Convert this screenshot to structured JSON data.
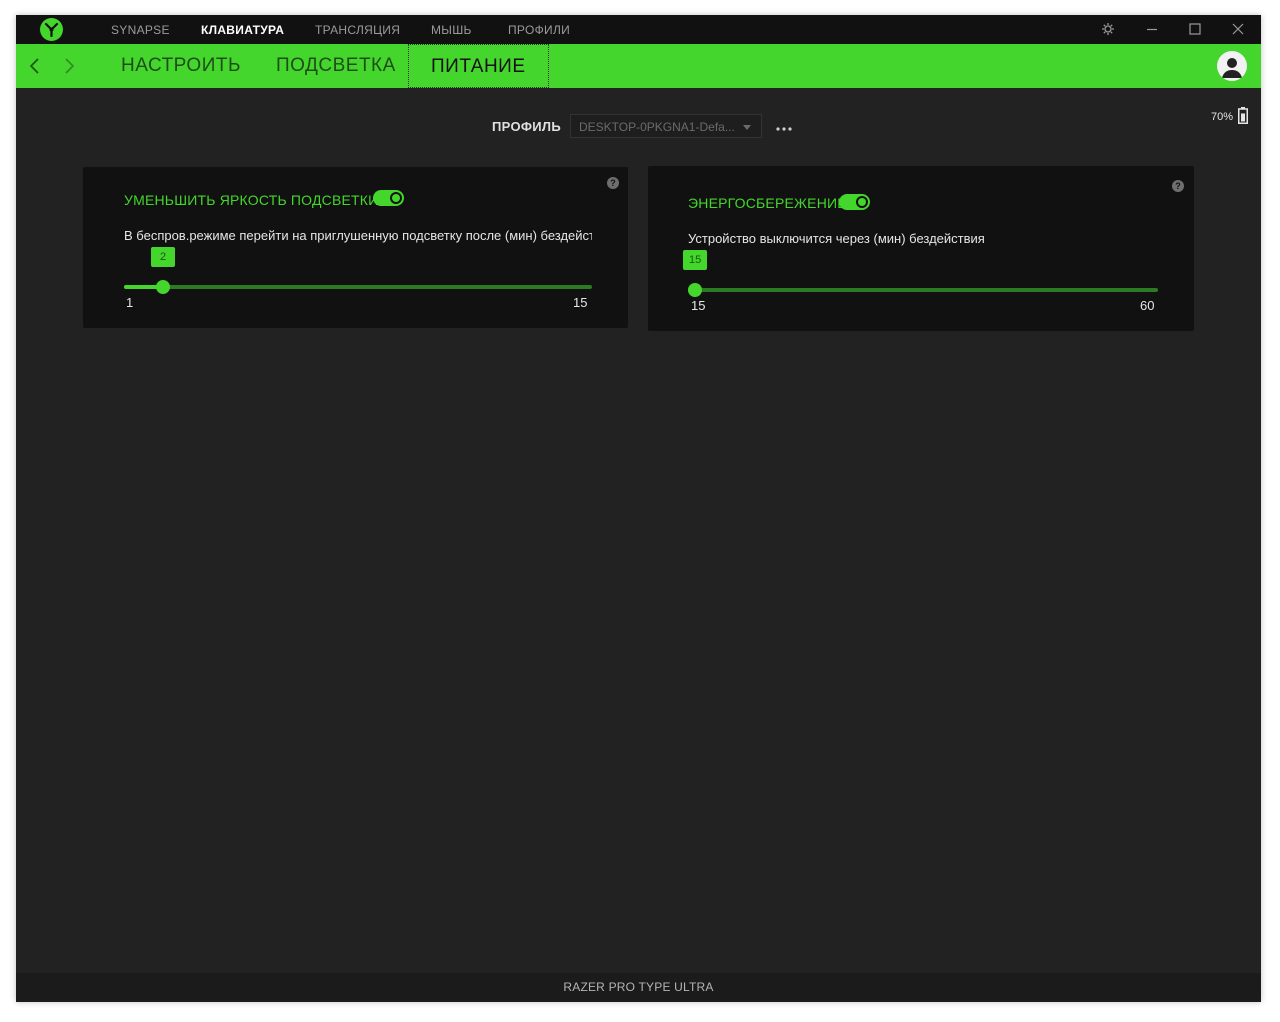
{
  "titlebar": {
    "tabs": [
      {
        "label": "SYNAPSE",
        "active": false
      },
      {
        "label": "КЛАВИАТУРА",
        "active": true
      },
      {
        "label": "ТРАНСЛЯЦИЯ",
        "active": false
      },
      {
        "label": "МЫШЬ",
        "active": false
      },
      {
        "label": "ПРОФИЛИ",
        "active": false
      }
    ],
    "icons": [
      "razer-logo-icon",
      "gear-icon",
      "minimize-icon",
      "maximize-icon",
      "close-icon"
    ]
  },
  "subnav": {
    "tabs": [
      {
        "label": "НАСТРОИТЬ",
        "active": false
      },
      {
        "label": "ПОДСВЕТКА",
        "active": false
      },
      {
        "label": "ПИТАНИЕ",
        "active": true
      }
    ]
  },
  "battery": {
    "percent_text": "70%",
    "level": 0.7
  },
  "profile": {
    "label": "ПРОФИЛЬ",
    "value": "DESKTOP-0PKGNA1-Defa..."
  },
  "cards": {
    "dim_lighting": {
      "title": "УМЕНЬШИТЬ ЯРКОСТЬ ПОДСВЕТКИ",
      "enabled": true,
      "description": "В беспров.режиме перейти на приглушенную подсветку после (мин) бездействия",
      "slider": {
        "value": 2,
        "value_text": "2",
        "min": 1,
        "max": 15,
        "min_text": "1",
        "max_text": "15"
      }
    },
    "power_saving": {
      "title": "ЭНЕРГОСБЕРЕЖЕНИЕ",
      "enabled": true,
      "description": "Устройство выключится через (мин) бездействия",
      "slider": {
        "value": 15,
        "value_text": "15",
        "min": 15,
        "max": 60,
        "min_text": "15",
        "max_text": "60"
      }
    }
  },
  "footer": {
    "device": "RAZER PRO TYPE ULTRA"
  },
  "colors": {
    "accent": "#44d62c",
    "background": "#222222",
    "card": "#111111"
  }
}
